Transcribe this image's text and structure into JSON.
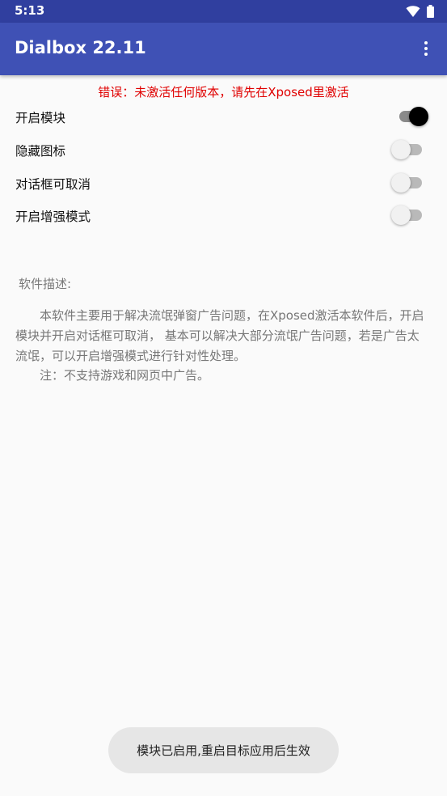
{
  "status_bar": {
    "time": "5:13",
    "wifi_icon": "wifi-icon",
    "battery_icon": "battery-icon"
  },
  "app_bar": {
    "title": "Dialbox 22.11",
    "overflow_icon": "more-vert-icon"
  },
  "error_message": "错误：未激活任何版本，请先在Xposed里激活",
  "switches": [
    {
      "label": "开启模块",
      "checked": true
    },
    {
      "label": "隐藏图标",
      "checked": false
    },
    {
      "label": "对话框可取消",
      "checked": false
    },
    {
      "label": "开启增强模式",
      "checked": false
    }
  ],
  "description": {
    "heading": "软件描述:",
    "line1": "本软件主要用于解决流氓弹窗广告问题，在Xposed激活本软件后，开启模块并开启对话框可取消， 基本可以解决大部分流氓广告问题，若是广告太流氓，可以开启增强模式进行针对性处理。",
    "line2": "注：不支持游戏和网页中广告。"
  },
  "toast": "模块已启用,重启目标应用后生效",
  "colors": {
    "primary": "#3f51b5",
    "primary_dark": "#303f9f",
    "error": "#e00000"
  }
}
